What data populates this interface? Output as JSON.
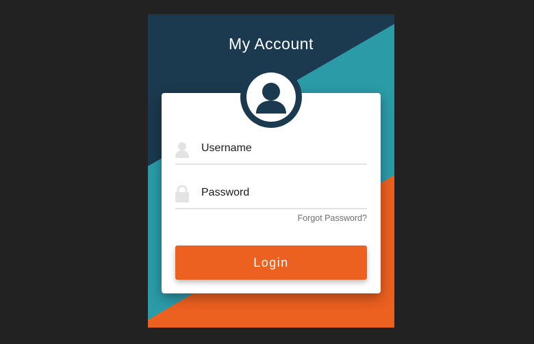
{
  "title": "My Account",
  "username": {
    "placeholder": "Username",
    "value": "",
    "icon": "user-icon"
  },
  "password": {
    "placeholder": "Password",
    "value": "",
    "icon": "lock-icon"
  },
  "forgot_label": "Forgot Password?",
  "login_label": "Login",
  "avatar_icon": "profile-avatar-icon",
  "colors": {
    "page_bg": "#222222",
    "navy": "#1b3a4f",
    "teal": "#2b9ba8",
    "orange": "#ec6020",
    "panel_bg": "#ffffff",
    "field_icon": "#e3e3e3",
    "muted_text": "#6f6f6f"
  }
}
